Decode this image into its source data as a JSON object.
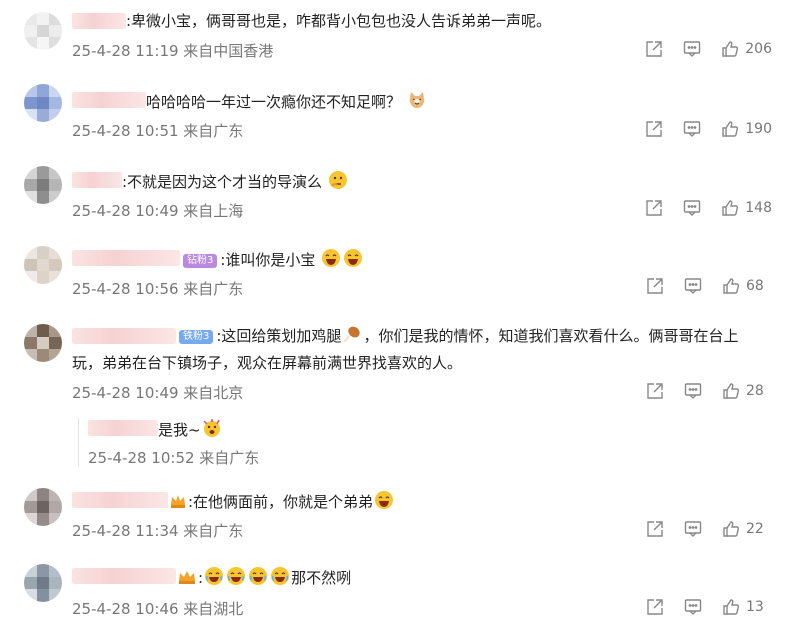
{
  "comments": [
    {
      "text": ":卑微小宝，俩哥哥也是，咋都背小包包也没人告诉弟弟一声呢。",
      "meta": "25-4-28 11:19 来自中国香港",
      "likes": "206"
    },
    {
      "text": "哈哈哈哈一年过一次瘾你还不知足啊？",
      "meta": "25-4-28 10:51 来自广东",
      "likes": "190"
    },
    {
      "text": ":不就是因为这个才当的导演么",
      "meta": "25-4-28 10:49 来自上海",
      "likes": "148"
    },
    {
      "badge": "钻粉3",
      "text": ":谁叫你是小宝",
      "meta": "25-4-28 10:56 来自广东",
      "likes": "68"
    },
    {
      "badge": "铁粉3",
      "text_a": ":这回给策划加鸡腿",
      "text_b": "，你们是我的情怀，知道我们喜欢看什么。俩哥哥在台上玩，弟弟在台下镇场子，观众在屏幕前满世界找喜欢的人。",
      "meta": "25-4-28 10:49 来自北京",
      "likes": "28"
    },
    {
      "text": "是我~",
      "meta": "25-4-28 10:52 来自广东"
    },
    {
      "text": ":在他俩面前，你就是个弟弟",
      "meta": "25-4-28 11:34 来自广东",
      "likes": "22"
    },
    {
      "text_a": ":",
      "text_b": "那不然咧",
      "meta": "25-4-28 10:46 来自湖北",
      "likes": "13"
    }
  ],
  "icons": {
    "share": "share-icon",
    "comment": "comment-icon",
    "like": "thumbs-up-icon"
  },
  "colors": {
    "text": "#222222",
    "meta": "#777777",
    "name_blur": "#f6d2d2"
  }
}
